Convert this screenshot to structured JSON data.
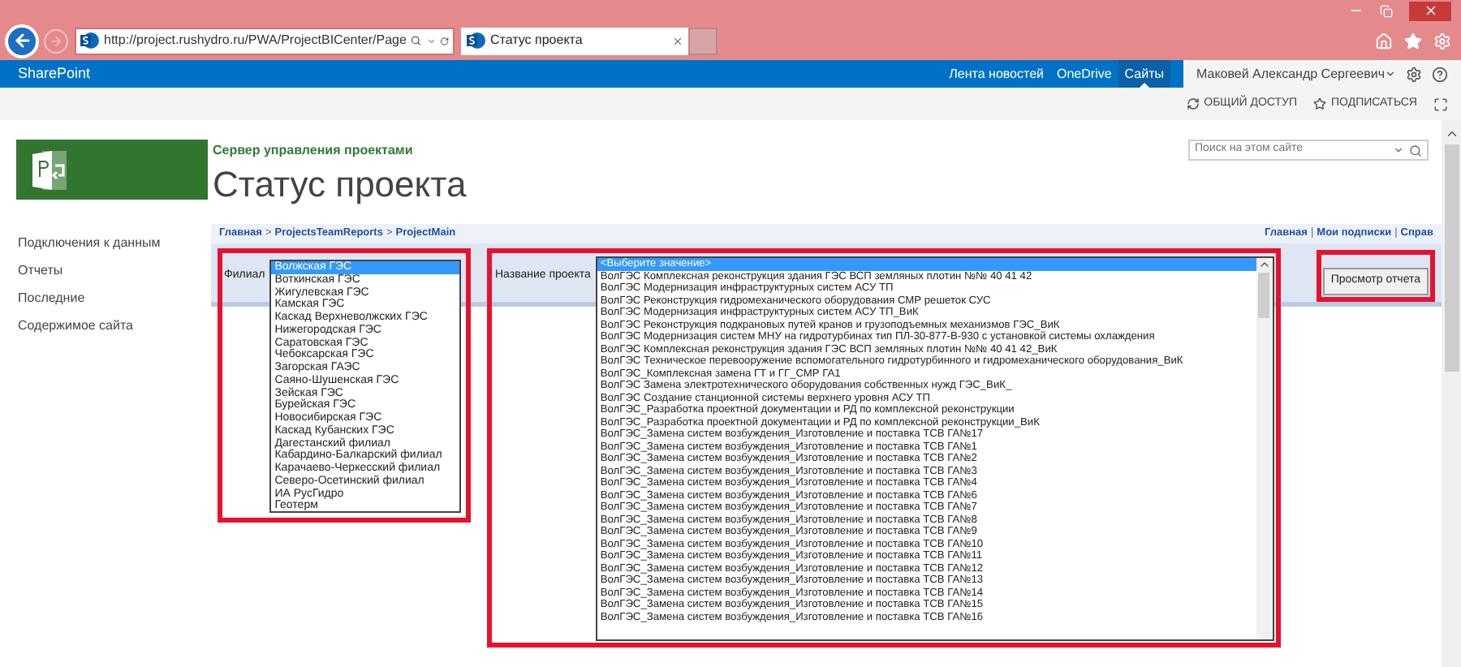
{
  "browser": {
    "url": "http://project.rushydro.ru/PWA/ProjectBICenter/Page",
    "tab_title": "Статус проекта"
  },
  "suite_bar": {
    "brand": "SharePoint",
    "links": [
      {
        "label": "Лента новостей",
        "selected": false
      },
      {
        "label": "OneDrive",
        "selected": false
      },
      {
        "label": "Сайты",
        "selected": true
      }
    ],
    "user": "Маковей Александр Сергеевич"
  },
  "actions": [
    "ОБЩИЙ ДОСТУП",
    "ПОДПИСАТЬСЯ"
  ],
  "site": {
    "subtitle": "Сервер управления проектами",
    "title": "Статус проекта",
    "search_placeholder": "Поиск на этом сайте"
  },
  "nav": [
    "Подключения к данным",
    "Отчеты",
    "Последние",
    "Содержимое сайта"
  ],
  "report": {
    "breadcrumb": [
      "Главная",
      "ProjectsTeamReports",
      "ProjectMain"
    ],
    "breadcrumb_separator": ">",
    "top_links": [
      "Главная",
      "Мои подписки",
      "Справ"
    ],
    "link_separator": "|",
    "parameters": [
      {
        "label": "Филиал",
        "highlighted": true,
        "options": [
          {
            "text": "Волжская ГЭС",
            "selected": true
          },
          {
            "text": "Воткинская ГЭС",
            "selected": false
          },
          {
            "text": "Жигулевская ГЭС",
            "selected": false
          },
          {
            "text": "Камская ГЭС",
            "selected": false
          },
          {
            "text": "Каскад Верхневолжских ГЭС",
            "selected": false
          },
          {
            "text": "Нижегородская ГЭС",
            "selected": false
          },
          {
            "text": "Саратовская ГЭС",
            "selected": false
          },
          {
            "text": "Чебоксарская ГЭС",
            "selected": false
          },
          {
            "text": "Загорская ГАЭС",
            "selected": false
          },
          {
            "text": "Саяно-Шушенская ГЭС",
            "selected": false
          },
          {
            "text": "Зейская ГЭС",
            "selected": false
          },
          {
            "text": "Бурейская ГЭС",
            "selected": false
          },
          {
            "text": "Новосибирская ГЭС",
            "selected": false
          },
          {
            "text": "Каскад Кубанских ГЭС",
            "selected": false
          },
          {
            "text": "Дагестанский филиал",
            "selected": false
          },
          {
            "text": "Кабардино-Балкарский филиал",
            "selected": false
          },
          {
            "text": "Карачаево-Черкесский филиал",
            "selected": false
          },
          {
            "text": "Северо-Осетинский филиал",
            "selected": false
          },
          {
            "text": "ИА РусГидро",
            "selected": false
          },
          {
            "text": "Геотерм",
            "selected": false
          }
        ]
      },
      {
        "label": "Название проекта",
        "highlighted": true,
        "options": [
          {
            "text": "<Выберите значение>",
            "selected": true
          },
          {
            "text": "ВолГЭС Комплексная реконструкция здания ГЭС ВСП земляных плотин №№ 40 41 42",
            "selected": false
          },
          {
            "text": "ВолГЭС Модернизация инфраструктурных систем АСУ ТП",
            "selected": false
          },
          {
            "text": "ВолГЭС Реконструкция гидромеханического оборудования СМР решеток СУС",
            "selected": false
          },
          {
            "text": "ВолГЭС Модернизация инфраструктурных систем АСУ ТП_ВиК",
            "selected": false
          },
          {
            "text": "ВолГЭС Реконструкция подкрановых путей кранов и грузоподъемных механизмов ГЭС_ВиК",
            "selected": false
          },
          {
            "text": "ВолГЭС Модернизация систем МНУ на гидротурбинах тип ПЛ-30-877-В-930 с установкой системы охлаждения",
            "selected": false
          },
          {
            "text": "ВолГЭС Комплексная реконструкция здания ГЭС ВСП земляных плотин №№ 40 41 42_ВиК",
            "selected": false
          },
          {
            "text": "ВолГЭС Техническое перевооружение вспомогательного гидротурбинного и гидромеханического оборудования_ВиК",
            "selected": false
          },
          {
            "text": "ВолГЭС_Комплексная замена ГТ и ГГ_СМР ГА1",
            "selected": false
          },
          {
            "text": "ВолГЭС Замена электротехнического оборудования собственных нужд ГЭС_ВиК_",
            "selected": false
          },
          {
            "text": "ВолГЭС Создание станционной системы верхнего уровня АСУ ТП",
            "selected": false
          },
          {
            "text": "ВолГЭС_Разработка проектной документации и РД по комплексной реконструкции",
            "selected": false
          },
          {
            "text": "ВолГЭС_Разработка проектной документации и РД по комплексной реконструкции_ВиК",
            "selected": false
          },
          {
            "text": "ВолГЭС_Замена систем возбуждения_Изготовление и поставка ТСВ ГА№17",
            "selected": false
          },
          {
            "text": "ВолГЭС_Замена систем возбуждения_Изготовление и поставка ТСВ ГА№1",
            "selected": false
          },
          {
            "text": "ВолГЭС_Замена систем возбуждения_Изготовление и поставка ТСВ ГА№2",
            "selected": false
          },
          {
            "text": "ВолГЭС_Замена систем возбуждения_Изготовление и поставка ТСВ ГА№3",
            "selected": false
          },
          {
            "text": "ВолГЭС_Замена систем возбуждения_Изготовление и поставка ТСВ ГА№4",
            "selected": false
          },
          {
            "text": "ВолГЭС_Замена систем возбуждения_Изготовление и поставка ТСВ ГА№6",
            "selected": false
          },
          {
            "text": "ВолГЭС_Замена систем возбуждения_Изготовление и поставка ТСВ ГА№7",
            "selected": false
          },
          {
            "text": "ВолГЭС_Замена систем возбуждения_Изготовление и поставка ТСВ ГА№8",
            "selected": false
          },
          {
            "text": "ВолГЭС_Замена систем возбуждения_Изготовление и поставка ТСВ ГА№9",
            "selected": false
          },
          {
            "text": "ВолГЭС_Замена систем возбуждения_Изготовление и поставка ТСВ ГА№10",
            "selected": false
          },
          {
            "text": "ВолГЭС_Замена систем возбуждения_Изготовление и поставка ТСВ ГА№11",
            "selected": false
          },
          {
            "text": "ВолГЭС_Замена систем возбуждения_Изготовление и поставка ТСВ ГА№12",
            "selected": false
          },
          {
            "text": "ВолГЭС_Замена систем возбуждения_Изготовление и поставка ТСВ ГА№13",
            "selected": false
          },
          {
            "text": "ВолГЭС_Замена систем возбуждения_Изготовление и поставка ТСВ ГА№14",
            "selected": false
          },
          {
            "text": "ВолГЭС_Замена систем возбуждения_Изготовление и поставка ТСВ ГА№15",
            "selected": false
          },
          {
            "text": "ВолГЭС_Замена систем возбуждения_Изготовление и поставка ТСВ ГА№16",
            "selected": false
          }
        ]
      }
    ],
    "view_button": {
      "label": "Просмотр отчета",
      "highlighted": true
    }
  }
}
